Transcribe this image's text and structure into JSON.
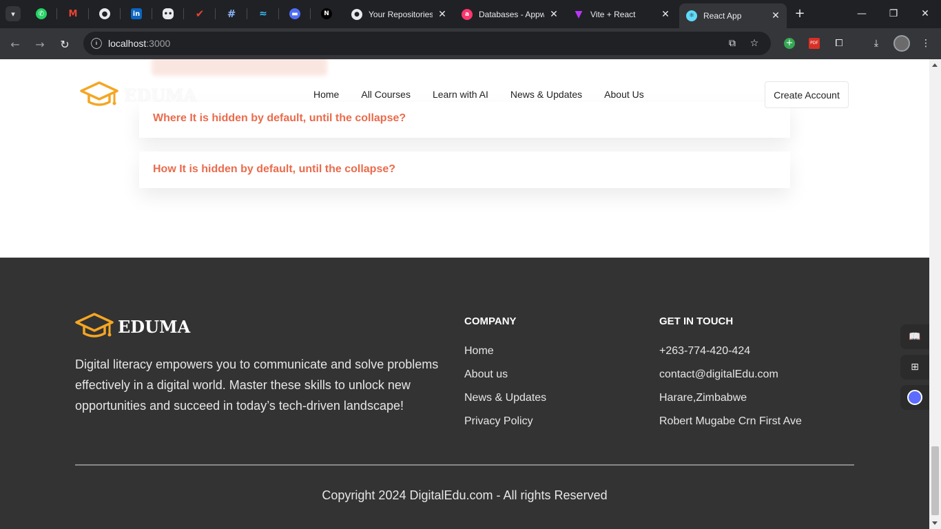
{
  "browser": {
    "pinned_tabs": [
      {
        "icon": "whatsapp-icon",
        "color": "#25d366"
      },
      {
        "icon": "gmail-icon",
        "color": "#ea4335"
      },
      {
        "icon": "github-icon",
        "color": "#e8eaed"
      },
      {
        "icon": "linkedin-icon",
        "color": "#0a66c2"
      },
      {
        "icon": "discord-icon",
        "color": "#e8eaed"
      },
      {
        "icon": "todoist-icon",
        "color": "#e44332"
      },
      {
        "icon": "hashnode-icon",
        "color": "#8ab4f8"
      },
      {
        "icon": "tailwind-icon",
        "color": "#38bdf8"
      },
      {
        "icon": "extension-app-icon",
        "color": "#4f6ef7"
      },
      {
        "icon": "nextjs-icon",
        "color": "#e8eaed"
      }
    ],
    "tabs": [
      {
        "title": "Your Repositories",
        "icon": "github-icon",
        "close": "✕"
      },
      {
        "title": "Databases - Appwrite",
        "icon": "appwrite-icon",
        "close": "✕"
      },
      {
        "title": "Vite + React",
        "icon": "vite-icon",
        "close": "✕"
      },
      {
        "title": "React App",
        "icon": "react-icon",
        "close": "✕",
        "active": true
      }
    ],
    "new_tab": "+",
    "window_controls": {
      "minimize": "—",
      "restore": "❐",
      "close": "✕"
    },
    "url_host": "localhost",
    "url_port": ":3000"
  },
  "page": {
    "faq_questions": [
      "Where It is hidden by default, until the collapse?",
      "How It is hidden by default, until the collapse?"
    ],
    "header": {
      "brand": "EDUMA",
      "nav": [
        "Home",
        "All Courses",
        "Learn with AI",
        "News & Updates",
        "About Us"
      ],
      "cta": "Create Account"
    },
    "footer": {
      "brand": "EDUMA",
      "description": "Digital literacy empowers you to communicate and solve problems effectively in a digital world. Master these skills to unlock new opportunities and succeed in today’s tech-driven landscape!",
      "company": {
        "title": "COMPANY",
        "links": [
          "Home",
          "About us",
          "News & Updates",
          "Privacy Policy"
        ]
      },
      "contact": {
        "title": "GET IN TOUCH",
        "items": [
          "+263-774-420-424",
          "contact@digitalEdu.com",
          "Harare,Zimbabwe",
          "Robert Mugabe Crn First Ave"
        ]
      },
      "copyright": "Copyright 2024 DigitalEdu.com - All rights Reserved"
    },
    "colors": {
      "accent": "#ea6b4c",
      "logo_gold": "#f5a623",
      "footer_bg": "#333333"
    }
  }
}
